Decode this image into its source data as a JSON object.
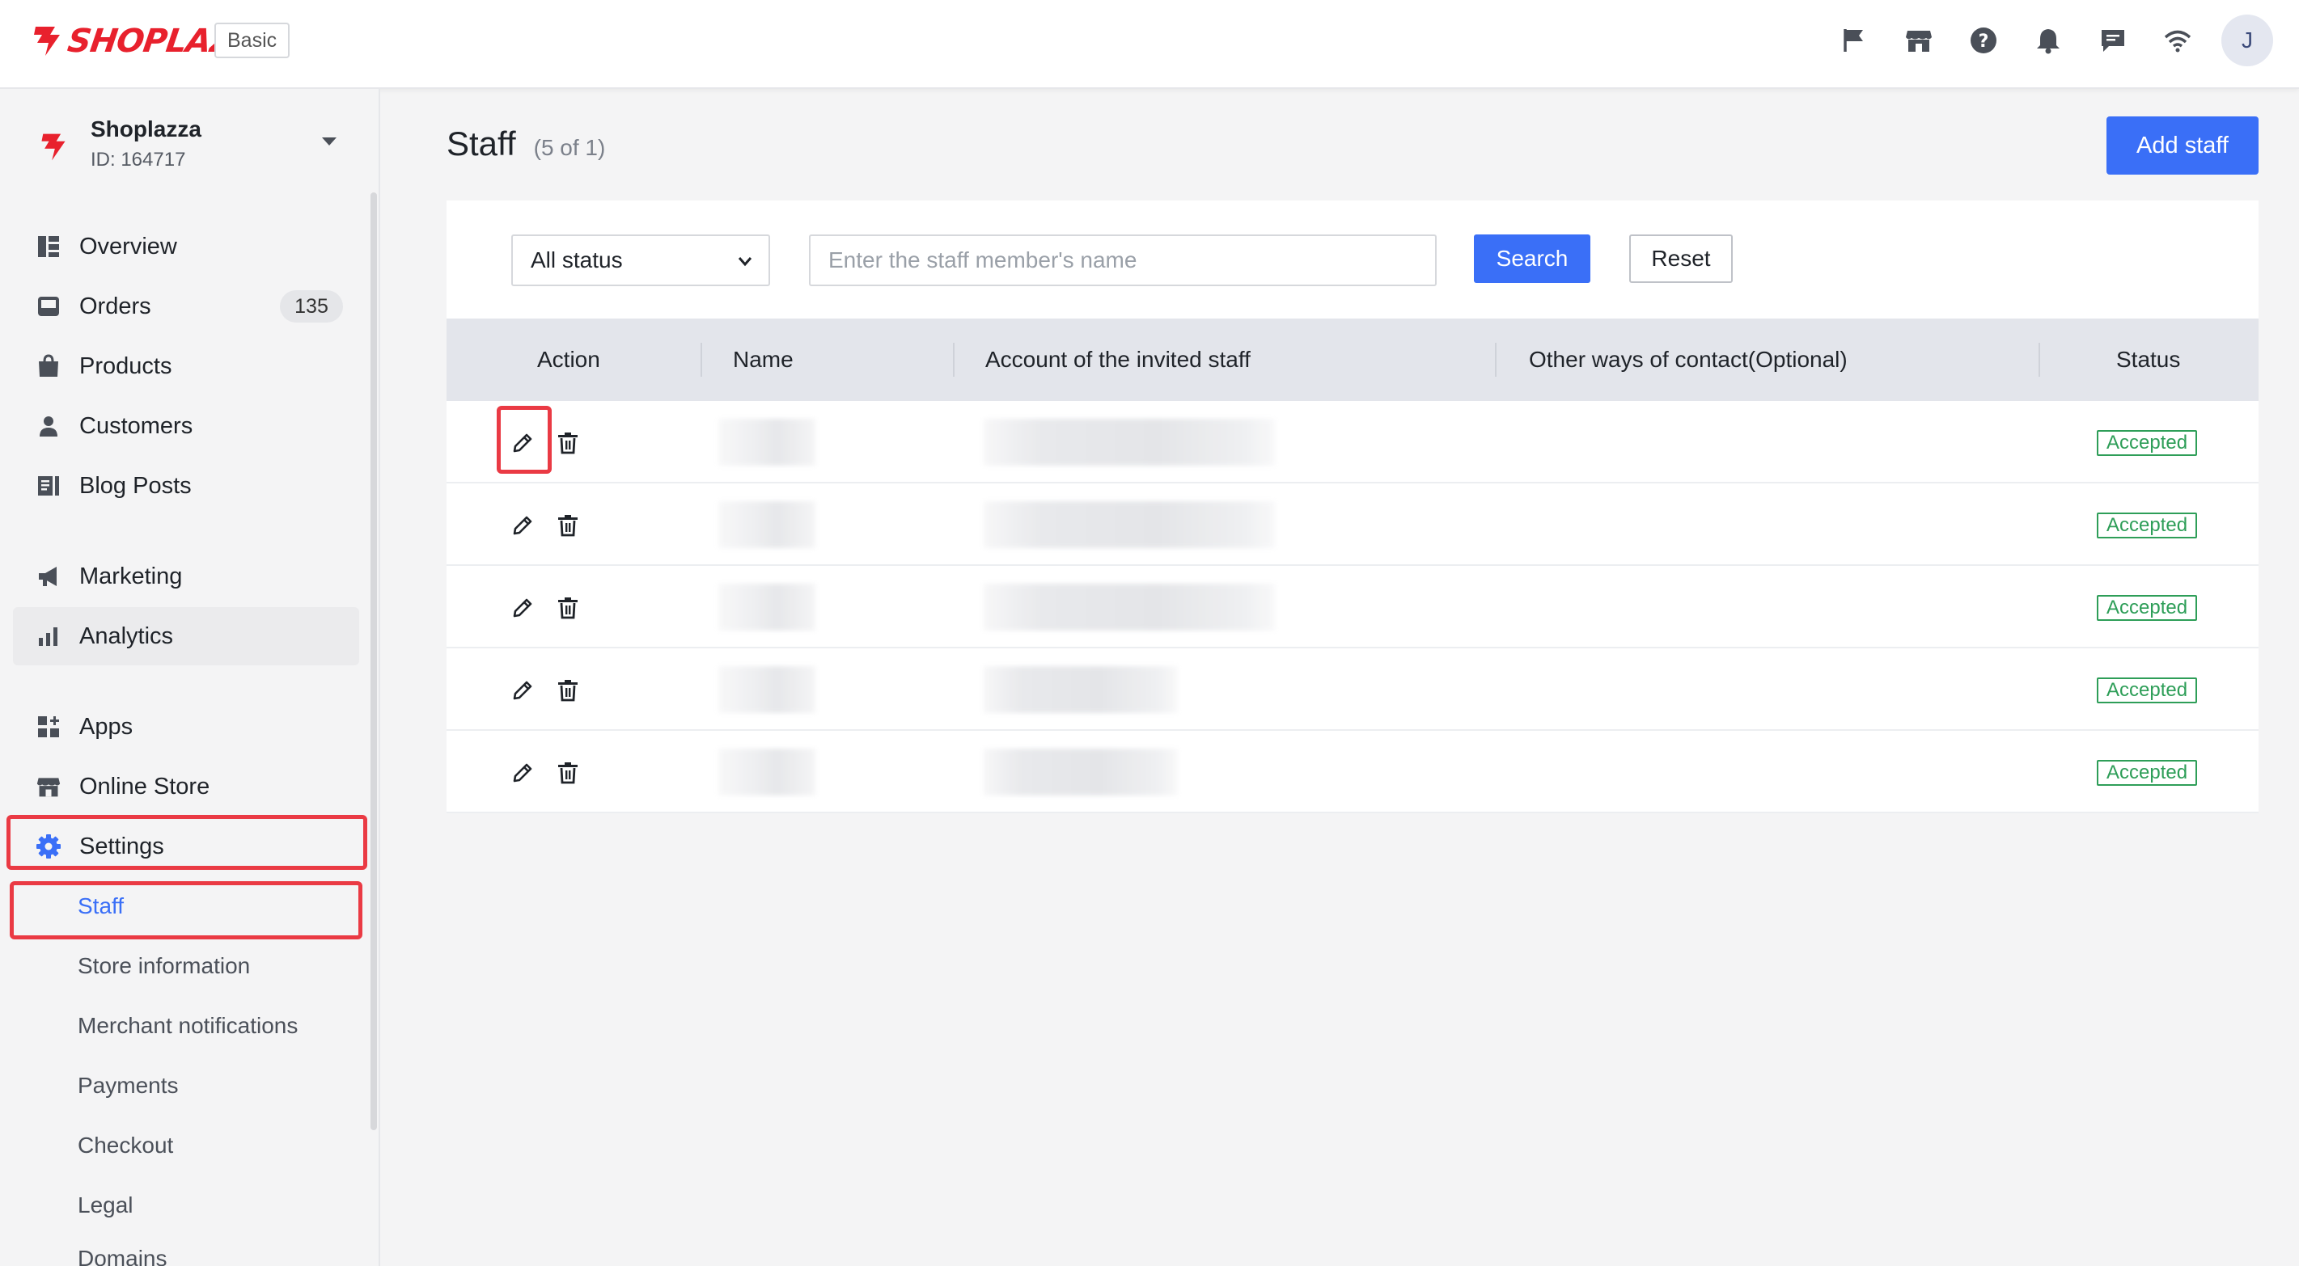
{
  "brand": {
    "logo_text": "SHOPLAZZA",
    "plan": "Basic",
    "accent": "#3a6ff7",
    "logo_color": "#e8212d"
  },
  "topbar": {
    "icons": [
      "flag-icon",
      "storefront-icon",
      "help-icon",
      "bell-icon",
      "chat-icon",
      "wifi-icon"
    ],
    "avatar_initial": "J"
  },
  "store": {
    "name": "Shoplazza",
    "id_label": "ID: 164717"
  },
  "sidebar": {
    "items": [
      {
        "label": "Overview",
        "icon": "overview-icon"
      },
      {
        "label": "Orders",
        "icon": "orders-icon",
        "badge": "135"
      },
      {
        "label": "Products",
        "icon": "products-icon"
      },
      {
        "label": "Customers",
        "icon": "customers-icon"
      },
      {
        "label": "Blog Posts",
        "icon": "blog-icon"
      },
      {
        "label": "Marketing",
        "icon": "megaphone-icon"
      },
      {
        "label": "Analytics",
        "icon": "analytics-icon"
      },
      {
        "label": "Apps",
        "icon": "apps-icon"
      },
      {
        "label": "Online Store",
        "icon": "storefront-icon"
      },
      {
        "label": "Settings",
        "icon": "gear-icon"
      }
    ],
    "settings_sub": [
      {
        "label": "Staff"
      },
      {
        "label": "Store information"
      },
      {
        "label": "Merchant notifications"
      },
      {
        "label": "Payments"
      },
      {
        "label": "Checkout"
      },
      {
        "label": "Legal"
      },
      {
        "label": "Domains"
      }
    ]
  },
  "page": {
    "title": "Staff",
    "count": "(5 of 1)",
    "add_button": "Add staff"
  },
  "filters": {
    "status_value": "All status",
    "search_placeholder": "Enter the staff member's name",
    "search_button": "Search",
    "reset_button": "Reset"
  },
  "table": {
    "columns": [
      "Action",
      "Name",
      "Account of the invited staff",
      "Other ways of contact(Optional)",
      "Status"
    ],
    "rows": [
      {
        "status": "Accepted"
      },
      {
        "status": "Accepted"
      },
      {
        "status": "Accepted"
      },
      {
        "status": "Accepted"
      },
      {
        "status": "Accepted"
      }
    ]
  }
}
